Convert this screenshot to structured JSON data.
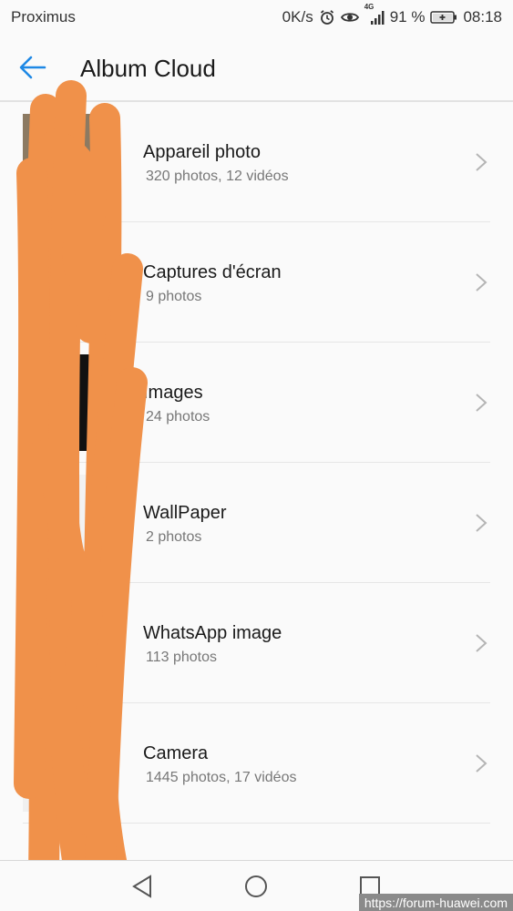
{
  "status_bar": {
    "carrier": "Proximus",
    "speed": "0K/s",
    "network": "4G",
    "battery": "91 %",
    "time": "08:18",
    "icons": [
      "alarm-icon",
      "eye-icon",
      "signal-icon",
      "battery-icon"
    ]
  },
  "app_bar": {
    "back_icon": "back-arrow-icon",
    "title": "Album Cloud"
  },
  "albums": [
    {
      "name": "Appareil photo",
      "count": "320 photos,  12 vidéos"
    },
    {
      "name": "Captures d'écran",
      "count": "9 photos"
    },
    {
      "name": "Images",
      "count": "24 photos"
    },
    {
      "name": "WallPaper",
      "count": "2 photos"
    },
    {
      "name": "WhatsApp image",
      "count": "113 photos"
    },
    {
      "name": "Camera",
      "count": "1445 photos,  17 vidéos"
    }
  ],
  "nav_bar": {
    "back": "nav-back-icon",
    "home": "nav-home-icon",
    "recents": "nav-recents-icon"
  },
  "watermark": "https://forum-huawei.com",
  "colors": {
    "accent": "#1e88e5",
    "scribble": "#f0914a",
    "background": "#fafafa"
  }
}
